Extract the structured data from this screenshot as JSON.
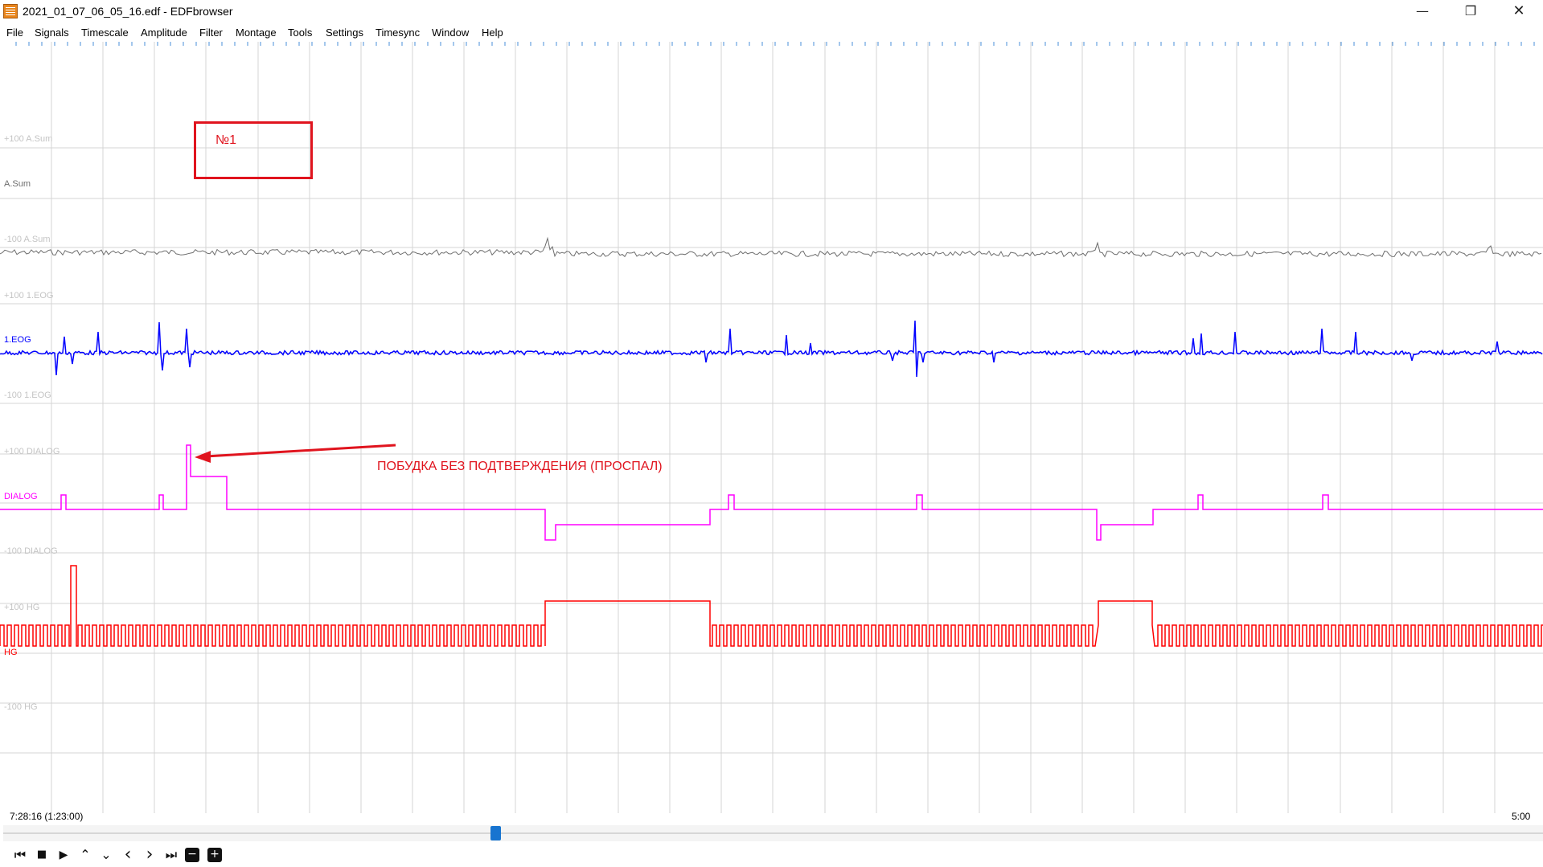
{
  "window": {
    "title": "2021_01_07_06_05_16.edf - EDFbrowser",
    "minimize": "—",
    "restore": "❐",
    "close": "✕"
  },
  "menu": {
    "items": [
      "File",
      "Signals",
      "Timescale",
      "Amplitude",
      "Filter",
      "Montage",
      "Tools",
      "Settings",
      "Timesync",
      "Window",
      "Help"
    ]
  },
  "signals": [
    {
      "label": "A.Sum",
      "upper": "+100 A.Sum",
      "lower": "-100 A.Sum",
      "color": "#6e6e6e"
    },
    {
      "label": "1.EOG",
      "upper": "+100 1.EOG",
      "lower": "-100 1.EOG",
      "color": "#0000ff"
    },
    {
      "label": "DIALOG",
      "upper": "+100 DIALOG",
      "lower": "-100 DIALOG",
      "color": "#ff00ff"
    },
    {
      "label": "HG",
      "upper": "+100 HG",
      "lower": "-100 HG",
      "color": "#ff0000"
    }
  ],
  "annotations": {
    "box_text": "№1",
    "arrow_text": "ПОБУДКА БЕЗ ПОДТВЕРЖДЕНИЯ (ПРОСПАЛ)",
    "color": "#e0141e"
  },
  "time": {
    "start": "7:28:16 (1:23:00)",
    "end": "5:00"
  },
  "toolbar": {
    "first": "⏮",
    "stop": "■",
    "play": "▶",
    "up": "⌃",
    "down": "⌄",
    "prev": "‹",
    "next": "›",
    "last": "⏭",
    "zoom_out": "−",
    "zoom_in": "+"
  },
  "colors": {
    "grid": "#d4d4d4",
    "scroll_thumb": "#1874d0",
    "ruler": "#4a8fd8"
  }
}
